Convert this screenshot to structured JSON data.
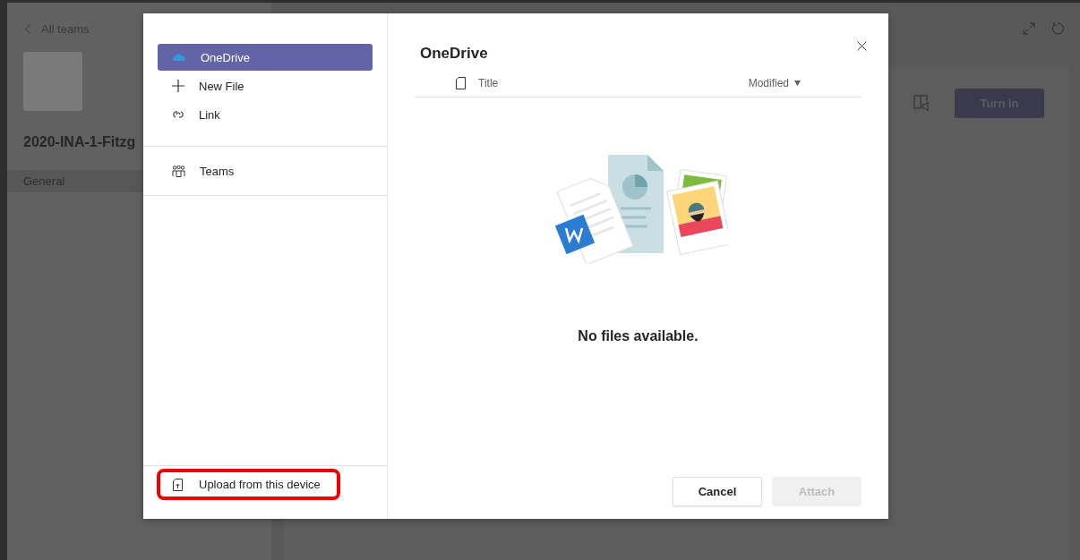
{
  "background": {
    "back_link": "All teams",
    "team_name": "2020-INA-1-Fitzg",
    "channel": "General",
    "turn_in_button": "Turn in"
  },
  "dialog": {
    "nav_groups": [
      {
        "items": [
          {
            "kind": "onedrive",
            "label": "OneDrive",
            "selected": true
          },
          {
            "kind": "new",
            "label": "New File",
            "selected": false
          },
          {
            "kind": "link",
            "label": "Link",
            "selected": false
          }
        ]
      },
      {
        "items": [
          {
            "kind": "teams",
            "label": "Teams",
            "selected": false
          }
        ]
      }
    ],
    "upload": {
      "label": "Upload from this device",
      "highlighted": true
    },
    "title": "OneDrive",
    "columns": [
      {
        "label": "Title",
        "kind": "title"
      },
      {
        "label": "Modified",
        "kind": "sort"
      }
    ],
    "empty_message": "No files available.",
    "buttons": [
      {
        "label": "Cancel",
        "disabled": false
      },
      {
        "label": "Attach",
        "disabled": true
      }
    ]
  }
}
